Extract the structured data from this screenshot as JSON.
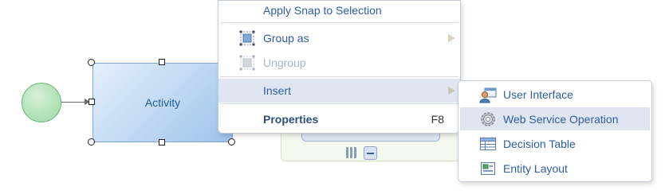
{
  "diagram": {
    "activity_label": "Activity"
  },
  "context_menu": {
    "items": [
      {
        "label": "Apply Snap to Selection",
        "icon": "none",
        "enabled": true
      },
      {
        "label": "Group as",
        "icon": "group-icon",
        "enabled": true,
        "has_submenu": true
      },
      {
        "label": "Ungroup",
        "icon": "ungroup-icon",
        "enabled": false
      },
      {
        "label": "Insert",
        "icon": "none",
        "enabled": true,
        "has_submenu": true,
        "active": true
      },
      {
        "label": "Properties",
        "icon": "none",
        "enabled": true,
        "bold": true,
        "shortcut": "F8"
      }
    ]
  },
  "insert_submenu": {
    "items": [
      {
        "label": "User Interface",
        "icon": "user-interface-icon"
      },
      {
        "label": "Web Service Operation",
        "icon": "gear-icon",
        "active": true
      },
      {
        "label": "Decision Table",
        "icon": "table-icon"
      },
      {
        "label": "Entity Layout",
        "icon": "entity-layout-icon"
      }
    ]
  },
  "colors": {
    "menu_text": "#2d5fa0",
    "menu_hover": "#dfe6f1",
    "activity_fill": "#c5dcf4",
    "start_event_fill": "#b5e3b9"
  }
}
